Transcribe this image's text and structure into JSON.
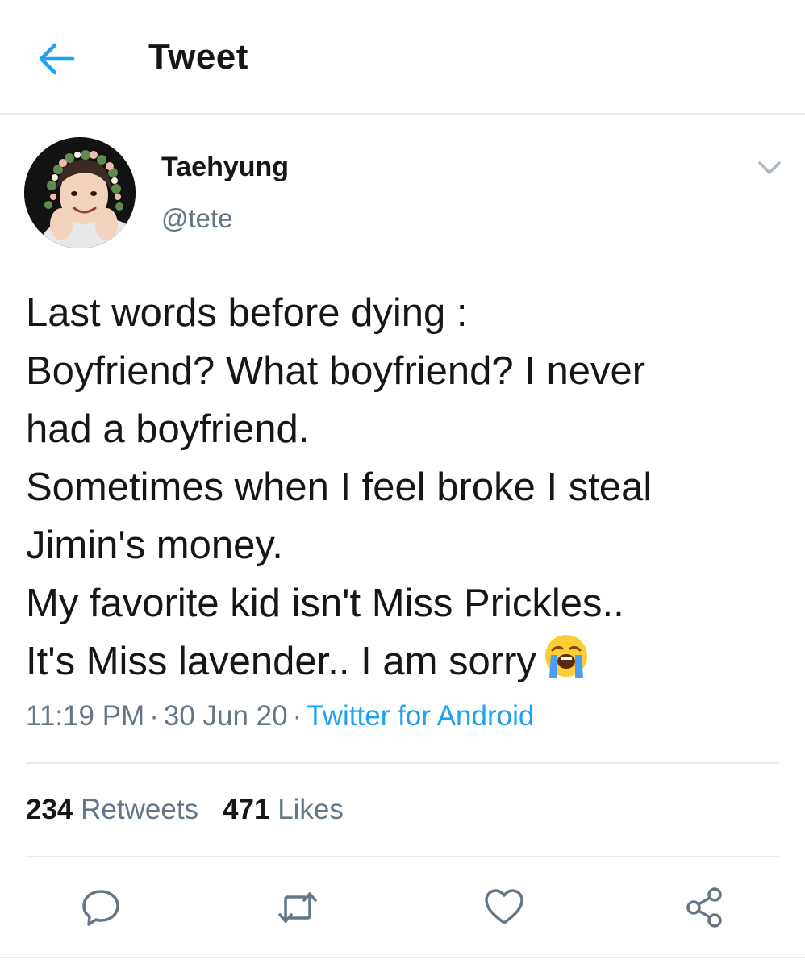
{
  "header": {
    "title": "Tweet",
    "back_icon": "arrow-left-icon",
    "accent_color": "#1da1f2"
  },
  "author": {
    "display_name": "Taehyung",
    "handle": "@tete",
    "avatar_icon": "profile-photo-avatar",
    "menu_icon": "chevron-down-icon"
  },
  "tweet": {
    "lines": [
      "Last words before dying :",
      "Boyfriend? What boyfriend? I never",
      "had a boyfriend.",
      "Sometimes when I feel broke I steal",
      "Jimin's money.",
      "My favorite kid isn't Miss Prickles..",
      "It's Miss lavender.. I am sorry"
    ],
    "emoji_icon": "loudly-crying-face-emoji"
  },
  "meta": {
    "time": "11:19 PM",
    "separator": "·",
    "date": "30 Jun 20",
    "source": "Twitter for Android"
  },
  "stats": {
    "retweets_count": "234",
    "retweets_label": "Retweets",
    "likes_count": "471",
    "likes_label": "Likes"
  },
  "actions": [
    {
      "icon": "reply-icon"
    },
    {
      "icon": "retweet-icon"
    },
    {
      "icon": "like-heart-icon"
    },
    {
      "icon": "share-icon"
    }
  ],
  "colors": {
    "text_primary": "#14171a",
    "text_secondary": "#657786",
    "link": "#1da1f2",
    "divider": "#e6ecf0"
  }
}
